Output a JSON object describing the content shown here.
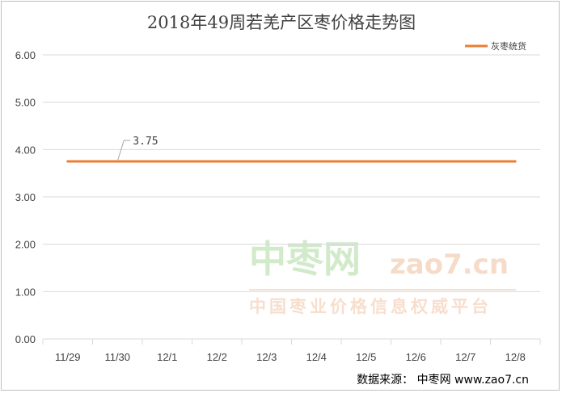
{
  "chart_data": {
    "type": "line",
    "title": "2018年49周若羌产区枣价格走势图",
    "categories": [
      "11/29",
      "11/30",
      "12/1",
      "12/2",
      "12/3",
      "12/4",
      "12/5",
      "12/6",
      "12/7",
      "12/8"
    ],
    "series": [
      {
        "name": "灰枣统货",
        "values": [
          3.75,
          3.75,
          3.75,
          3.75,
          3.75,
          3.75,
          3.75,
          3.75,
          3.75,
          3.75
        ],
        "color": "#ed7d31"
      }
    ],
    "ylim": [
      0,
      6
    ],
    "yticks": [
      "0.00",
      "1.00",
      "2.00",
      "3.00",
      "4.00",
      "5.00",
      "6.00"
    ],
    "data_label": "3.75",
    "legend_position": "top-right",
    "grid": true
  },
  "source": "数据来源：  中枣网 www.zao7.cn",
  "watermark": {
    "logo_text": "中枣网",
    "logo_latin": "zao7.cn",
    "tagline": "中国枣业价格信息权威平台"
  },
  "colors": {
    "grid": "#d9d9d9",
    "axis": "#d9d9d9",
    "text": "#404040"
  }
}
